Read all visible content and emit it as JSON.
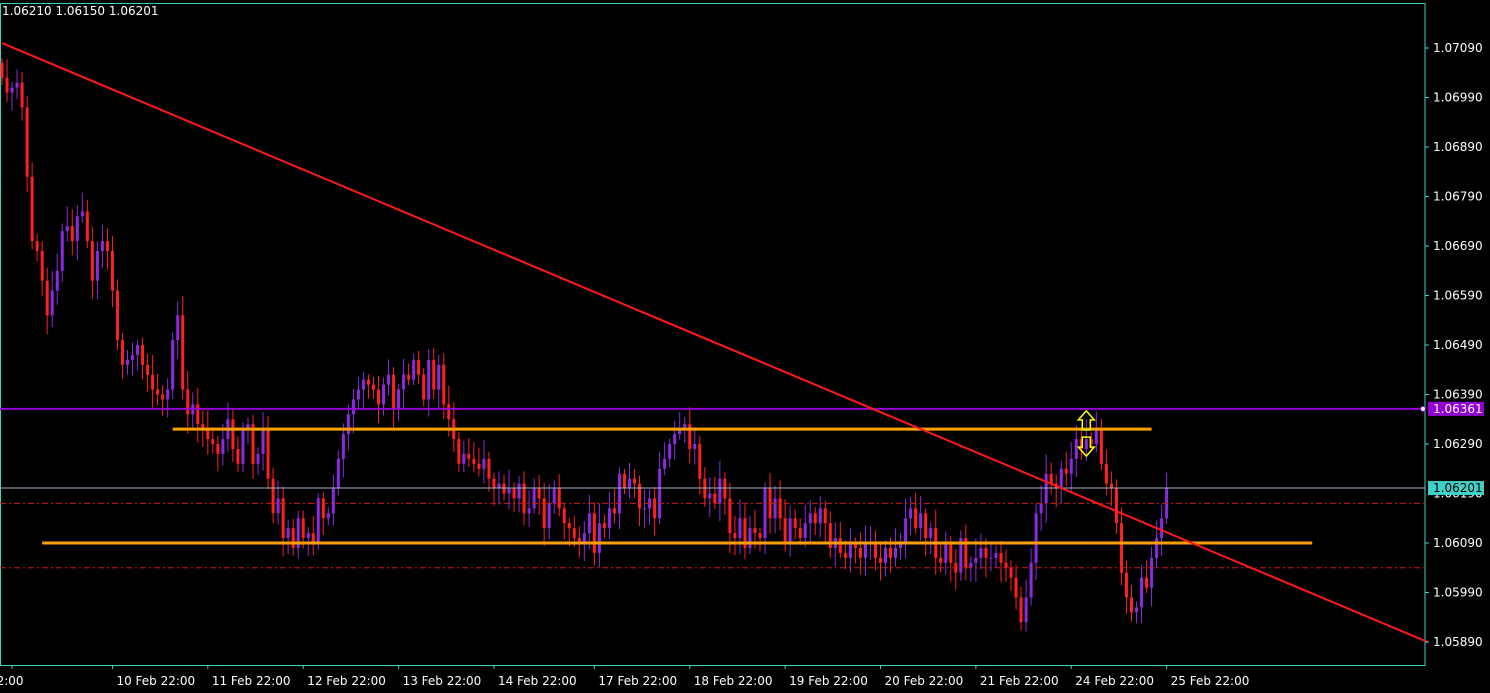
{
  "header": {
    "ohlc_text": "1.06210 1.06150 1.06201"
  },
  "colors": {
    "background": "#000000",
    "frame": "#3fd0c0",
    "candle_up": "#8a2be2",
    "candle_down": "#ff2020",
    "trendline": "#ff1a1a",
    "sr_line": "#ffa000",
    "resistance_line": "#9400d3",
    "dashed_line": "#c81e1e",
    "arrow": "#ffff00",
    "axis_text": "#ffffff"
  },
  "icons": {
    "up_arrow": "hollow-up-arrow-icon",
    "down_arrow": "hollow-down-arrow-icon"
  },
  "chart_data": {
    "type": "candlestick",
    "title": "",
    "price_axis": {
      "ticks": [
        1.0709,
        1.0699,
        1.0689,
        1.0679,
        1.0669,
        1.0659,
        1.0649,
        1.0639,
        1.0629,
        1.0609,
        1.0599,
        1.0589
      ],
      "tick_labels": [
        "1.07090",
        "1.06990",
        "1.06890",
        "1.06790",
        "1.06690",
        "1.06590",
        "1.06490",
        "1.06390",
        "1.06290",
        "1.06090",
        "1.05990",
        "1.05890"
      ],
      "range": [
        1.0586,
        1.0713
      ],
      "hidden_tick_label": "1.06190"
    },
    "time_axis": {
      "labels": [
        "2:00",
        "10 Feb 22:00",
        "11 Feb 22:00",
        "12 Feb 22:00",
        "13 Feb 22:00",
        "14 Feb 22:00",
        "17 Feb 22:00",
        "18 Feb 22:00",
        "19 Feb 22:00",
        "20 Feb 22:00",
        "21 Feb 22:00",
        "24 Feb 22:00",
        "25 Feb 22:00"
      ],
      "label_bar_index": [
        2,
        22,
        41,
        60,
        79,
        98,
        118,
        137,
        156,
        175,
        194,
        213,
        232
      ]
    },
    "price_tags": {
      "horizontal_line": "1.06361",
      "bid": "1.06201"
    },
    "levels": {
      "horizontal_line": 1.06361,
      "bid": 1.06201,
      "upper_sr": 1.0632,
      "lower_sr": 1.0609,
      "dashed_upper": 1.0617,
      "dashed_lower": 1.0604
    },
    "trendline": {
      "from": {
        "bar": 0,
        "price": 1.071
      },
      "to": {
        "bar": 284,
        "price": 1.0589
      }
    },
    "sr_line_spans": {
      "upper": {
        "from_bar": 34,
        "to_bar": 229
      },
      "lower": {
        "from_bar": 8,
        "to_bar": 261
      }
    },
    "arrow_markers_bar": 216,
    "closes": [
      1.0703,
      1.07,
      1.0701,
      1.0702,
      1.0697,
      1.0683,
      1.067,
      1.0668,
      1.0662,
      1.0655,
      1.066,
      1.0664,
      1.0672,
      1.0673,
      1.067,
      1.0675,
      1.0676,
      1.067,
      1.0662,
      1.0668,
      1.067,
      1.0668,
      1.066,
      1.065,
      1.0645,
      1.0646,
      1.0647,
      1.0649,
      1.0645,
      1.0643,
      1.064,
      1.0639,
      1.0638,
      1.064,
      1.065,
      1.0655,
      1.064,
      1.0635,
      1.0637,
      1.0633,
      1.0632,
      1.063,
      1.0629,
      1.0627,
      1.063,
      1.0634,
      1.0628,
      1.0625,
      1.0632,
      1.0633,
      1.0625,
      1.0627,
      1.0632,
      1.0622,
      1.0615,
      1.0618,
      1.061,
      1.0612,
      1.0608,
      1.0614,
      1.061,
      1.0611,
      1.0609,
      1.0618,
      1.0614,
      1.0615,
      1.062,
      1.0626,
      1.0631,
      1.0635,
      1.0638,
      1.064,
      1.0642,
      1.0641,
      1.064,
      1.0637,
      1.0641,
      1.0643,
      1.0636,
      1.064,
      1.0643,
      1.0642,
      1.0646,
      1.0643,
      1.0638,
      1.0646,
      1.064,
      1.0645,
      1.0637,
      1.0634,
      1.063,
      1.0625,
      1.0627,
      1.0626,
      1.0625,
      1.0624,
      1.0626,
      1.0622,
      1.062,
      1.0621,
      1.0619,
      1.062,
      1.0618,
      1.0621,
      1.0615,
      1.0616,
      1.062,
      1.0618,
      1.0612,
      1.0617,
      1.062,
      1.0616,
      1.0613,
      1.0612,
      1.061,
      1.0609,
      1.0611,
      1.0615,
      1.0607,
      1.0613,
      1.0612,
      1.0616,
      1.0615,
      1.0623,
      1.062,
      1.0622,
      1.0621,
      1.0616,
      1.0616,
      1.0618,
      1.0614,
      1.0624,
      1.0626,
      1.0629,
      1.0631,
      1.0632,
      1.0633,
      1.0628,
      1.0629,
      1.0622,
      1.0618,
      1.0619,
      1.0617,
      1.0622,
      1.0618,
      1.0611,
      1.061,
      1.0614,
      1.0608,
      1.0612,
      1.0611,
      1.061,
      1.062,
      1.0614,
      1.0618,
      1.0614,
      1.0609,
      1.0614,
      1.0612,
      1.061,
      1.0613,
      1.0615,
      1.0613,
      1.0616,
      1.0613,
      1.0608,
      1.061,
      1.0607,
      1.0606,
      1.0609,
      1.0608,
      1.0606,
      1.0609,
      1.0609,
      1.0606,
      1.0605,
      1.0608,
      1.0606,
      1.0608,
      1.0609,
      1.0614,
      1.0616,
      1.0612,
      1.0615,
      1.061,
      1.0612,
      1.0606,
      1.0605,
      1.0609,
      1.0605,
      1.0603,
      1.061,
      1.0604,
      1.0605,
      1.0606,
      1.0608,
      1.0606,
      1.0606,
      1.0607,
      1.0605,
      1.0604,
      1.0602,
      1.0598,
      1.0593,
      1.0598,
      1.0605,
      1.0615,
      1.0617,
      1.0623,
      1.0621,
      1.062,
      1.0624,
      1.0623,
      1.0626,
      1.063,
      1.0628,
      1.063,
      1.0629,
      1.0632,
      1.0625,
      1.0621,
      1.062,
      1.0613,
      1.0603,
      1.0598,
      1.0595,
      1.0596,
      1.0602,
      1.06,
      1.0606,
      1.061,
      1.0614,
      1.062
    ]
  }
}
